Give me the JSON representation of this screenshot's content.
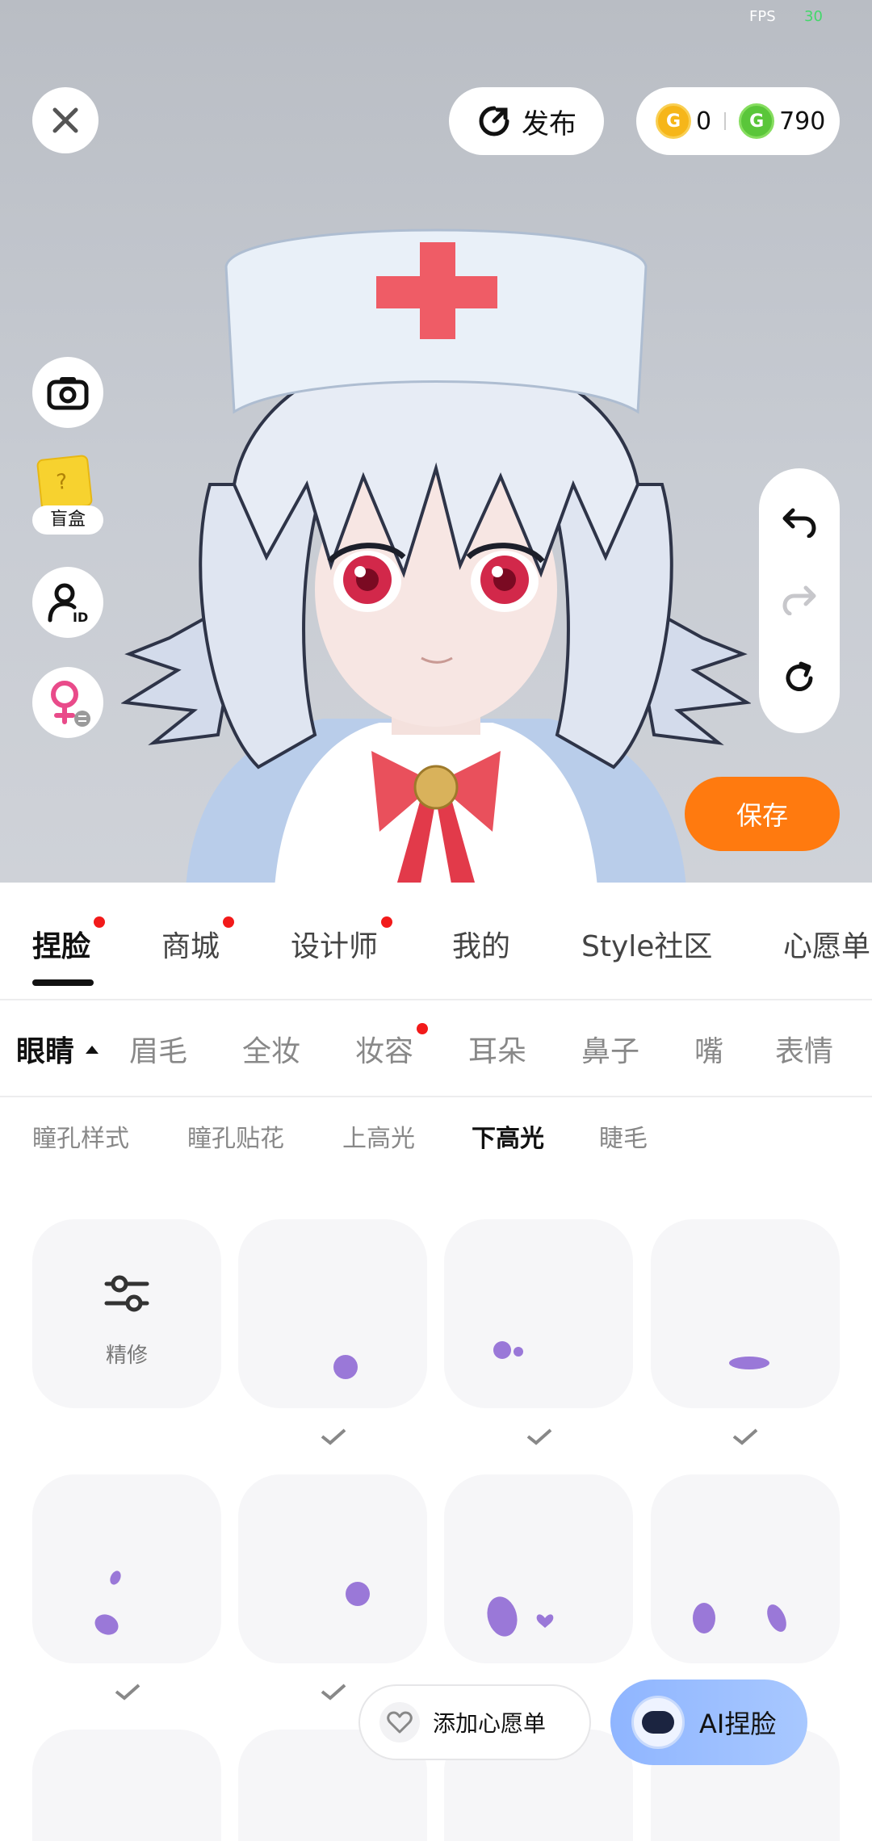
{
  "status": {
    "fps_label": "FPS",
    "fps_value": "30"
  },
  "top_bar": {
    "publish_label": "发布",
    "gold_coins": "0",
    "green_coins": "790"
  },
  "side": {
    "blind_box_label": "盲盒"
  },
  "save_label": "保存",
  "main_tabs": [
    {
      "label": "捏脸",
      "active": true,
      "dot": true
    },
    {
      "label": "商城",
      "dot": true
    },
    {
      "label": "设计师",
      "dot": true
    },
    {
      "label": "我的"
    },
    {
      "label": "Style社区"
    },
    {
      "label": "心愿单"
    }
  ],
  "sub_tabs": [
    {
      "label": "眼睛",
      "active": true
    },
    {
      "label": "眉毛"
    },
    {
      "label": "全妆"
    },
    {
      "label": "妆容",
      "dot": true
    },
    {
      "label": "耳朵"
    },
    {
      "label": "鼻子"
    },
    {
      "label": "嘴"
    },
    {
      "label": "表情"
    }
  ],
  "option_tabs": [
    {
      "label": "瞳孔样式"
    },
    {
      "label": "瞳孔贴花"
    },
    {
      "label": "上高光"
    },
    {
      "label": "下高光",
      "active": true
    },
    {
      "label": "睫毛"
    }
  ],
  "refine_label": "精修",
  "wishlist_label": "添加心愿单",
  "ai_face_label": "AI捏脸",
  "colors": {
    "accent_orange": "#ff7a0f",
    "swatch_purple": "#9a78d8",
    "notify_red": "#f21a1a"
  }
}
